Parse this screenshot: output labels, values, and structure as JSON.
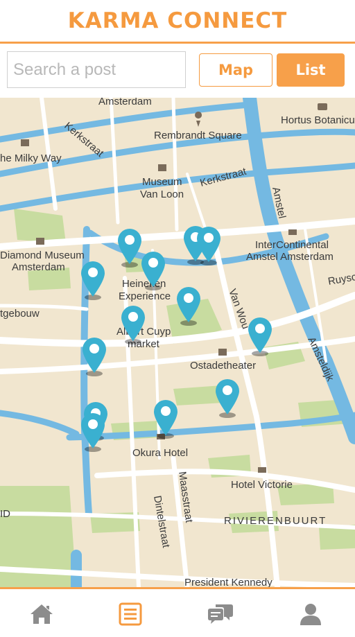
{
  "header": {
    "title": "KARMA CONNECT"
  },
  "search": {
    "placeholder": "Search a post",
    "value": ""
  },
  "view_toggle": {
    "map_label": "Map",
    "list_label": "List",
    "active": "List"
  },
  "map": {
    "labels": {
      "amsterdam_top": "Amsterdam",
      "rembrandt": "Rembrandt Square",
      "hortus": "Hortus Botanicu",
      "kerkstraat1": "Kerkstraat",
      "kerkstraat2": "Kerkstraat",
      "milky_way": "he Milky Way",
      "museum1": "Museum",
      "museum2": "Van Loon",
      "amstel": "Amstel",
      "diamond1": "Diamond Museum",
      "diamond2": "Amsterdam",
      "intercont1": "InterContinental",
      "intercont2": "Amstel Amsterdam",
      "ruysch": "Ruysc",
      "heineken1": "Heineken",
      "heineken2": "Experience",
      "vanwou": "Van Wou",
      "gebouw": "tgebouw",
      "cuyp1": "Albert Cuyp",
      "cuyp2": "market",
      "amsteldijk": "Amsteldijk",
      "ostade": "Ostadetheater",
      "okura": "Okura Hotel",
      "maasstraat": "Maasstraat",
      "victorie": "Hotel Victorie",
      "dintel": "Dintelstraat",
      "rivieren": "RIVIERENBUURT",
      "zuid": "ID",
      "president": "President Kennedy"
    },
    "pin_color": "#3ab0d0",
    "pin_count": 13
  },
  "nav": {
    "items": [
      {
        "name": "home",
        "icon": "home-icon"
      },
      {
        "name": "list",
        "icon": "list-icon",
        "active": true
      },
      {
        "name": "chat",
        "icon": "chat-icon"
      },
      {
        "name": "profile",
        "icon": "user-icon"
      }
    ],
    "active_color": "#f59a3f",
    "inactive_color": "#8c8c8c"
  }
}
